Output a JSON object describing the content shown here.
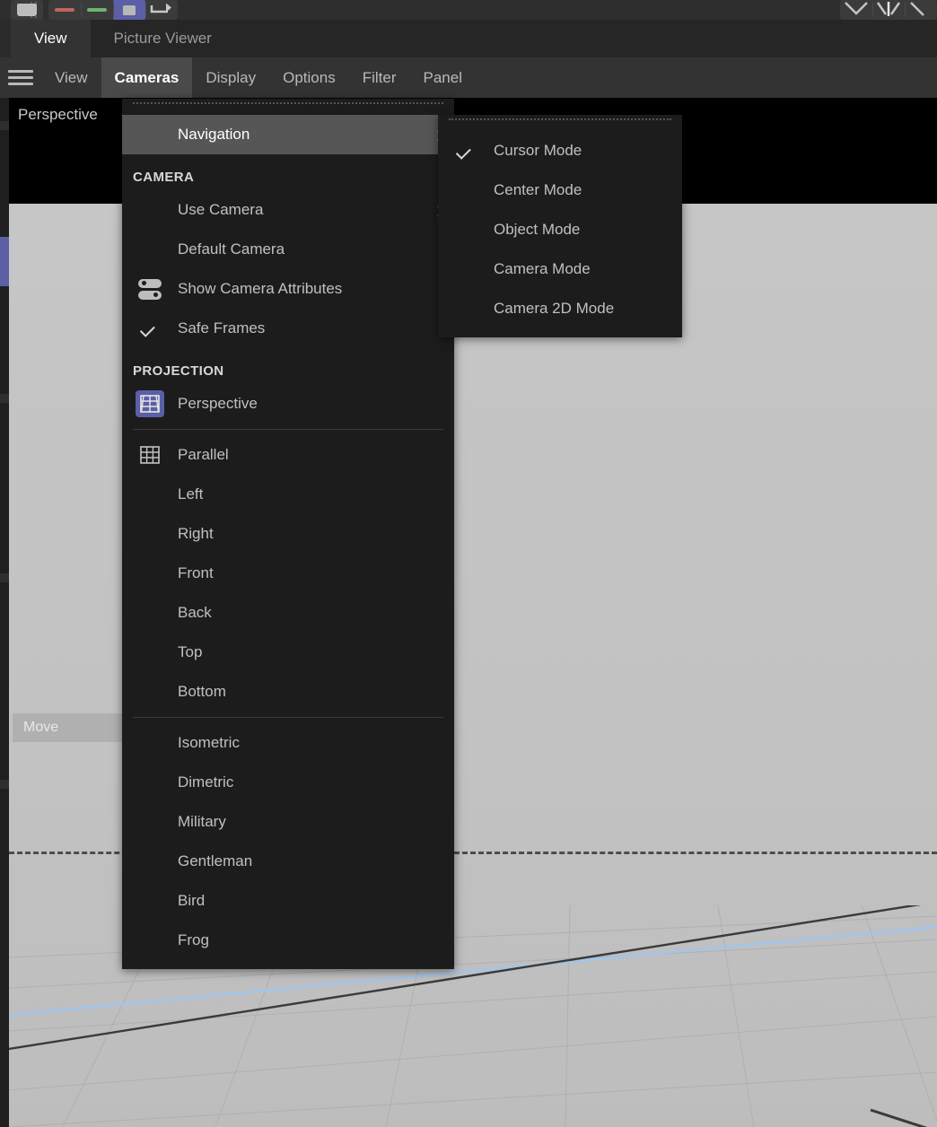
{
  "top_toolbar": {
    "groups": [
      {
        "name": "file-group",
        "buttons": [
          {
            "icon": "folder-icon",
            "active": false
          }
        ]
      },
      {
        "name": "color-group",
        "buttons": [
          {
            "icon": "red-bar-icon",
            "active": false
          },
          {
            "icon": "green-bar-icon",
            "active": false
          },
          {
            "icon": "object-chip-icon",
            "active": true
          },
          {
            "icon": "arrow-right-icon",
            "active": false
          }
        ]
      },
      {
        "name": "right-group",
        "buttons": [
          {
            "icon": "chevron-down-icon",
            "active": false
          },
          {
            "icon": "mirror-icon",
            "active": false
          },
          {
            "icon": "corner-icon",
            "active": false
          }
        ]
      }
    ]
  },
  "tabs": [
    {
      "label": "View",
      "active": true
    },
    {
      "label": "Picture Viewer",
      "active": false
    }
  ],
  "menubar": {
    "hamburger_icon": "hamburger-icon",
    "items": [
      {
        "label": "View",
        "active": false
      },
      {
        "label": "Cameras",
        "active": true
      },
      {
        "label": "Display",
        "active": false
      },
      {
        "label": "Options",
        "active": false
      },
      {
        "label": "Filter",
        "active": false
      },
      {
        "label": "Panel",
        "active": false
      }
    ]
  },
  "viewport": {
    "label": "Perspective",
    "tool_chip": "Move"
  },
  "cameras_menu": {
    "rows": [
      {
        "kind": "dotted"
      },
      {
        "kind": "item",
        "label": "Navigation",
        "highlighted": true,
        "submenu": true,
        "checked": false,
        "icon": null
      },
      {
        "kind": "section",
        "label": "CAMERA"
      },
      {
        "kind": "item",
        "label": "Use Camera",
        "highlighted": false,
        "submenu": true,
        "checked": false,
        "icon": null
      },
      {
        "kind": "item",
        "label": "Default Camera",
        "highlighted": false,
        "submenu": false,
        "checked": false,
        "icon": null
      },
      {
        "kind": "item",
        "label": "Show Camera Attributes",
        "highlighted": false,
        "submenu": false,
        "checked": false,
        "icon": "camera-attributes-icon"
      },
      {
        "kind": "item",
        "label": "Safe Frames",
        "highlighted": false,
        "submenu": false,
        "checked": true,
        "icon": null
      },
      {
        "kind": "section",
        "label": "PROJECTION"
      },
      {
        "kind": "item",
        "label": "Perspective",
        "highlighted": false,
        "submenu": false,
        "checked": false,
        "icon": "perspective-grid-icon",
        "icon_active": true
      },
      {
        "kind": "separator"
      },
      {
        "kind": "item",
        "label": "Parallel",
        "highlighted": false,
        "submenu": false,
        "checked": false,
        "icon": "parallel-grid-icon"
      },
      {
        "kind": "item",
        "label": "Left",
        "highlighted": false,
        "submenu": false,
        "checked": false,
        "icon": null
      },
      {
        "kind": "item",
        "label": "Right",
        "highlighted": false,
        "submenu": false,
        "checked": false,
        "icon": null
      },
      {
        "kind": "item",
        "label": "Front",
        "highlighted": false,
        "submenu": false,
        "checked": false,
        "icon": null
      },
      {
        "kind": "item",
        "label": "Back",
        "highlighted": false,
        "submenu": false,
        "checked": false,
        "icon": null
      },
      {
        "kind": "item",
        "label": "Top",
        "highlighted": false,
        "submenu": false,
        "checked": false,
        "icon": null
      },
      {
        "kind": "item",
        "label": "Bottom",
        "highlighted": false,
        "submenu": false,
        "checked": false,
        "icon": null
      },
      {
        "kind": "separator"
      },
      {
        "kind": "item",
        "label": "Isometric",
        "highlighted": false,
        "submenu": false,
        "checked": false,
        "icon": null
      },
      {
        "kind": "item",
        "label": "Dimetric",
        "highlighted": false,
        "submenu": false,
        "checked": false,
        "icon": null
      },
      {
        "kind": "item",
        "label": "Military",
        "highlighted": false,
        "submenu": false,
        "checked": false,
        "icon": null
      },
      {
        "kind": "item",
        "label": "Gentleman",
        "highlighted": false,
        "submenu": false,
        "checked": false,
        "icon": null
      },
      {
        "kind": "item",
        "label": "Bird",
        "highlighted": false,
        "submenu": false,
        "checked": false,
        "icon": null
      },
      {
        "kind": "item",
        "label": "Frog",
        "highlighted": false,
        "submenu": false,
        "checked": false,
        "icon": null
      }
    ]
  },
  "navigation_submenu": {
    "rows": [
      {
        "kind": "dotted"
      },
      {
        "kind": "item",
        "label": "Cursor Mode",
        "checked": true
      },
      {
        "kind": "item",
        "label": "Center Mode",
        "checked": false
      },
      {
        "kind": "item",
        "label": "Object Mode",
        "checked": false
      },
      {
        "kind": "item",
        "label": "Camera Mode",
        "checked": false
      },
      {
        "kind": "item",
        "label": "Camera 2D Mode",
        "checked": false
      }
    ]
  },
  "colors": {
    "menu_background": "#1c1c1c",
    "menu_highlight": "#565656",
    "accent_blue": "#5b5fa6",
    "menubar_background": "#333333",
    "viewport_ground": "#c2c2c2",
    "axis_blue": "#9ec6f0",
    "text_primary": "#c0c0c0"
  }
}
